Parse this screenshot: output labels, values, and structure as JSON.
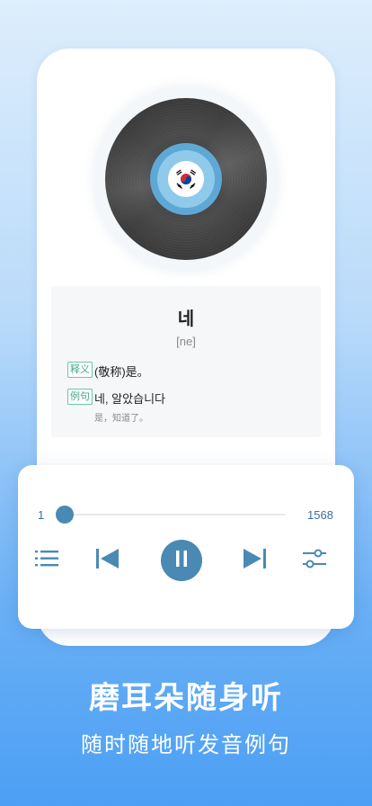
{
  "word_card": {
    "word": "네",
    "phonetic": "[ne]",
    "definition_tag": "释义",
    "definition": "(敬称)是。",
    "example_tag": "例句",
    "example": "네, 알았습니다",
    "example_translation": "是，知道了。"
  },
  "player": {
    "current_index": "1",
    "total": "1568",
    "progress_fraction": 0.0,
    "accent_color": "#4a89b3",
    "controls": [
      "list-icon",
      "previous-icon",
      "pause-icon",
      "next-icon",
      "settings-sliders-icon"
    ]
  },
  "promo": {
    "headline": "磨耳朵随身听",
    "subline": "随时随地听发音例句"
  }
}
